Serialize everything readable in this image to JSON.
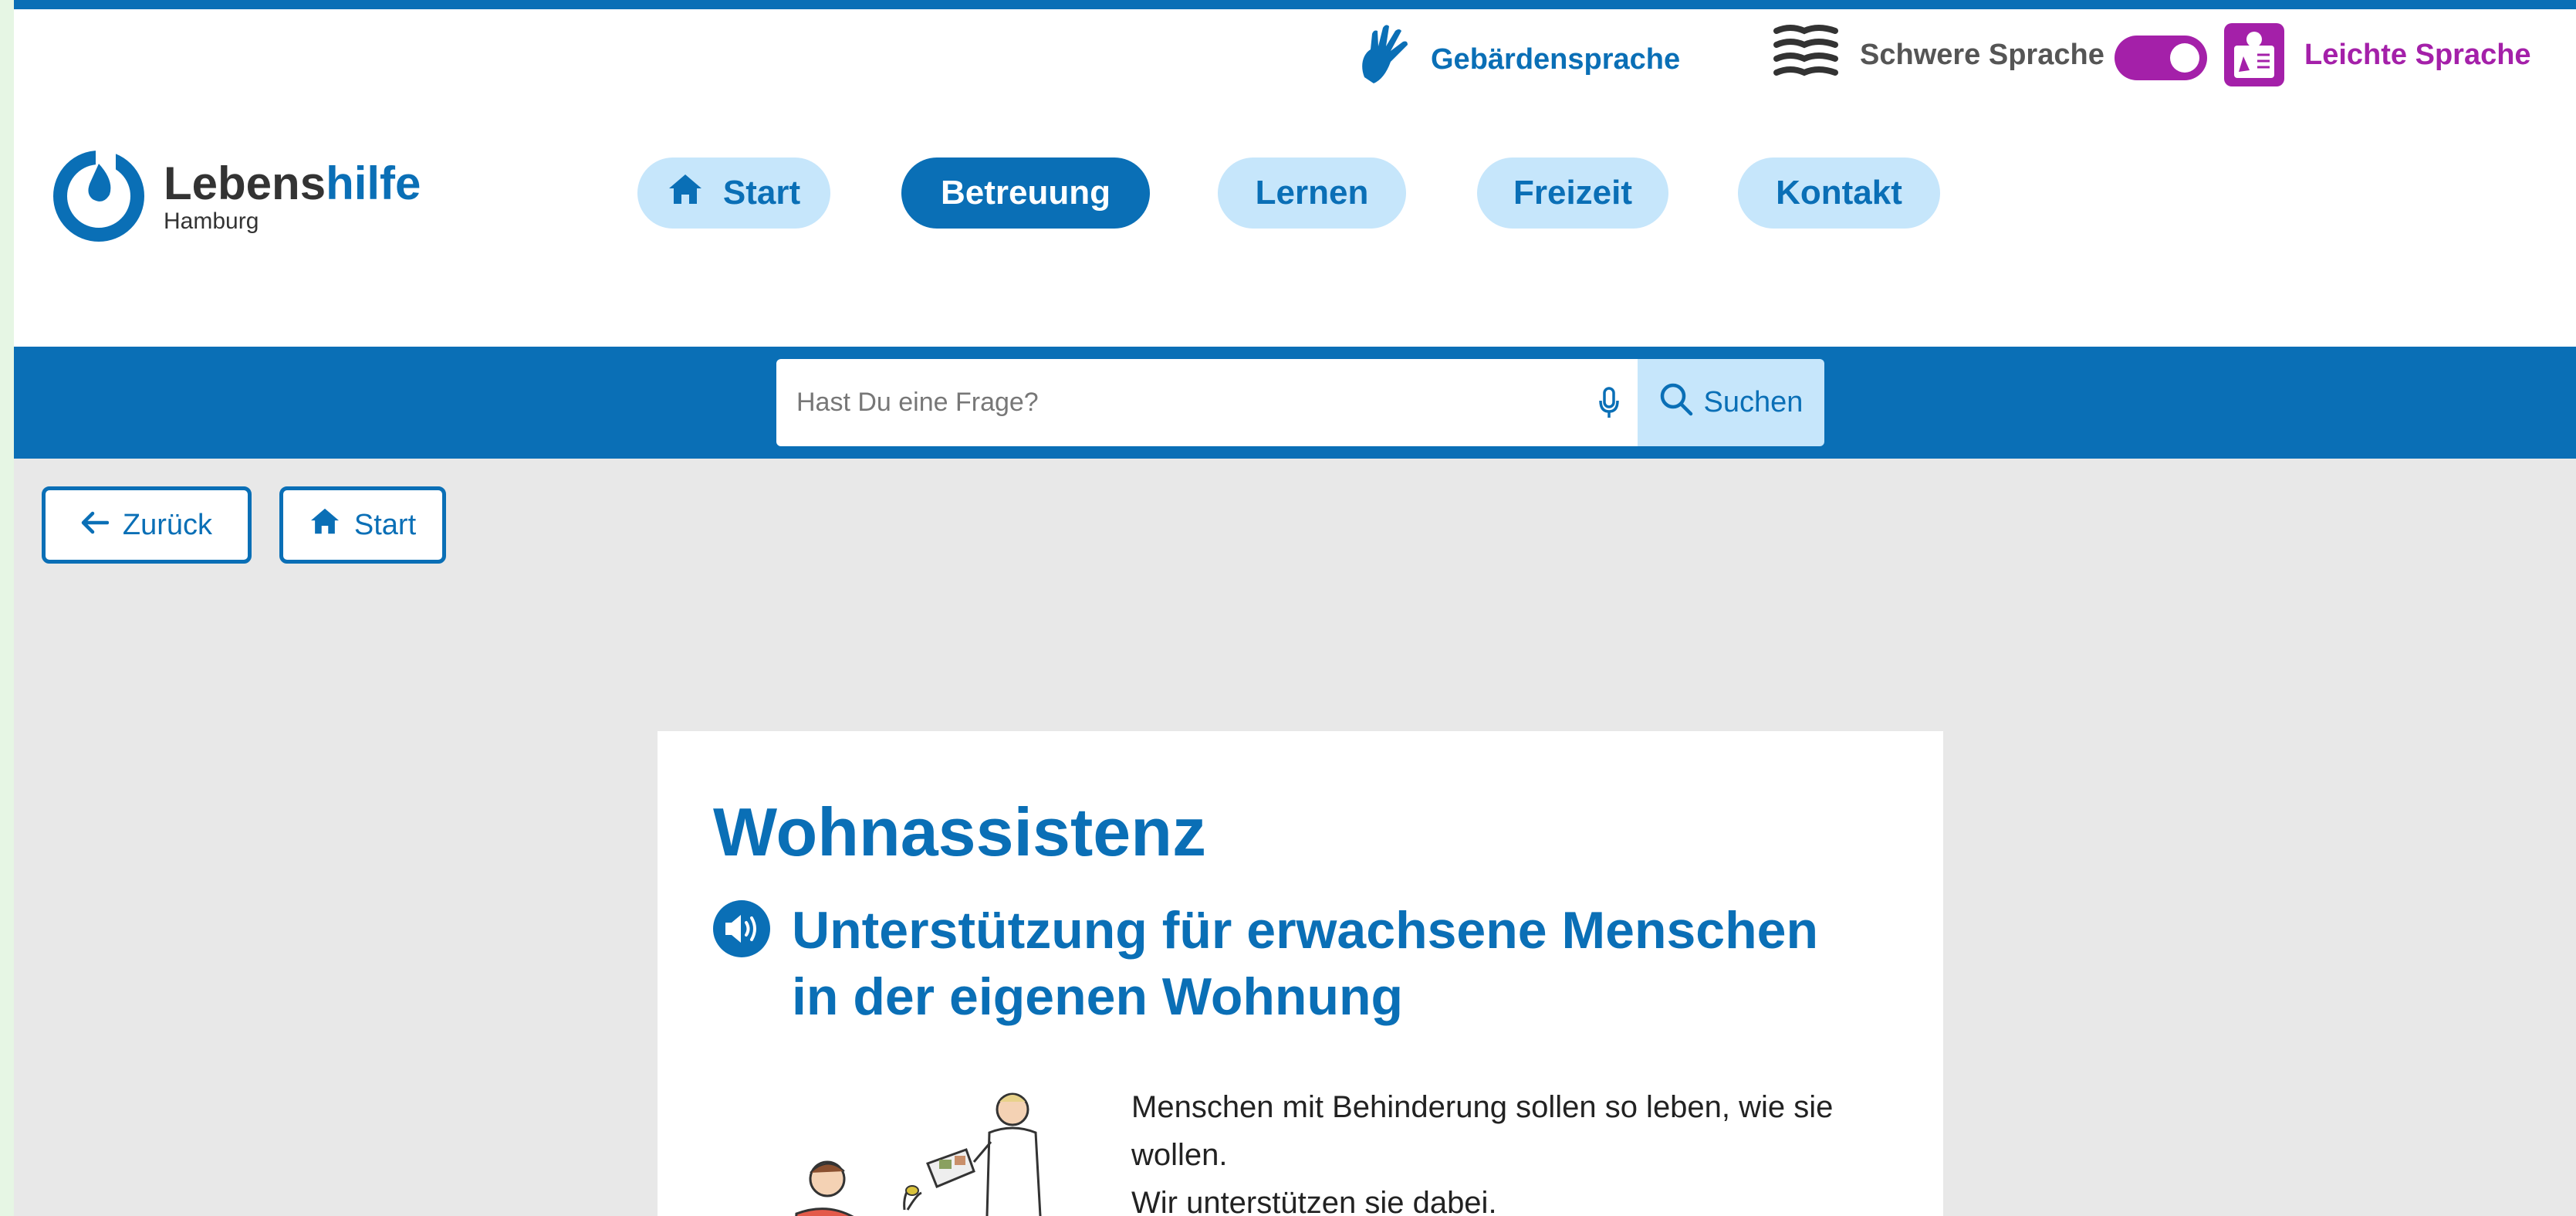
{
  "language_bar": {
    "sign_language": "Gebärdensprache",
    "hard_language": "Schwere Sprache",
    "easy_language": "Leichte Sprache",
    "toggle_state": "Leichte Sprache"
  },
  "logo": {
    "brand_part1": "Lebens",
    "brand_part2": "hilfe",
    "city": "Hamburg"
  },
  "nav": {
    "items": [
      {
        "label": "Start",
        "icon": "home-icon",
        "active": false
      },
      {
        "label": "Betreuung",
        "active": true
      },
      {
        "label": "Lernen",
        "active": false
      },
      {
        "label": "Freizeit",
        "active": false
      },
      {
        "label": "Kontakt",
        "active": false
      }
    ]
  },
  "search": {
    "placeholder": "Hast Du eine Frage?",
    "button_label": "Suchen"
  },
  "back_nav": {
    "back_label": "Zurück",
    "start_label": "Start"
  },
  "content": {
    "title": "Wohnassistenz",
    "subtitle": "Unterstützung für erwachsene Menschen in der eigenen Wohnung",
    "body_lines": [
      "Menschen mit Behinderung sollen so leben, wie sie",
      "wollen.",
      "Wir unterstützen sie dabei."
    ]
  },
  "colors": {
    "primary": "#0a6fb6",
    "light_blue": "#c6e6fb",
    "easy_language": "#a420a9",
    "page_bg": "#e8e8e8"
  }
}
